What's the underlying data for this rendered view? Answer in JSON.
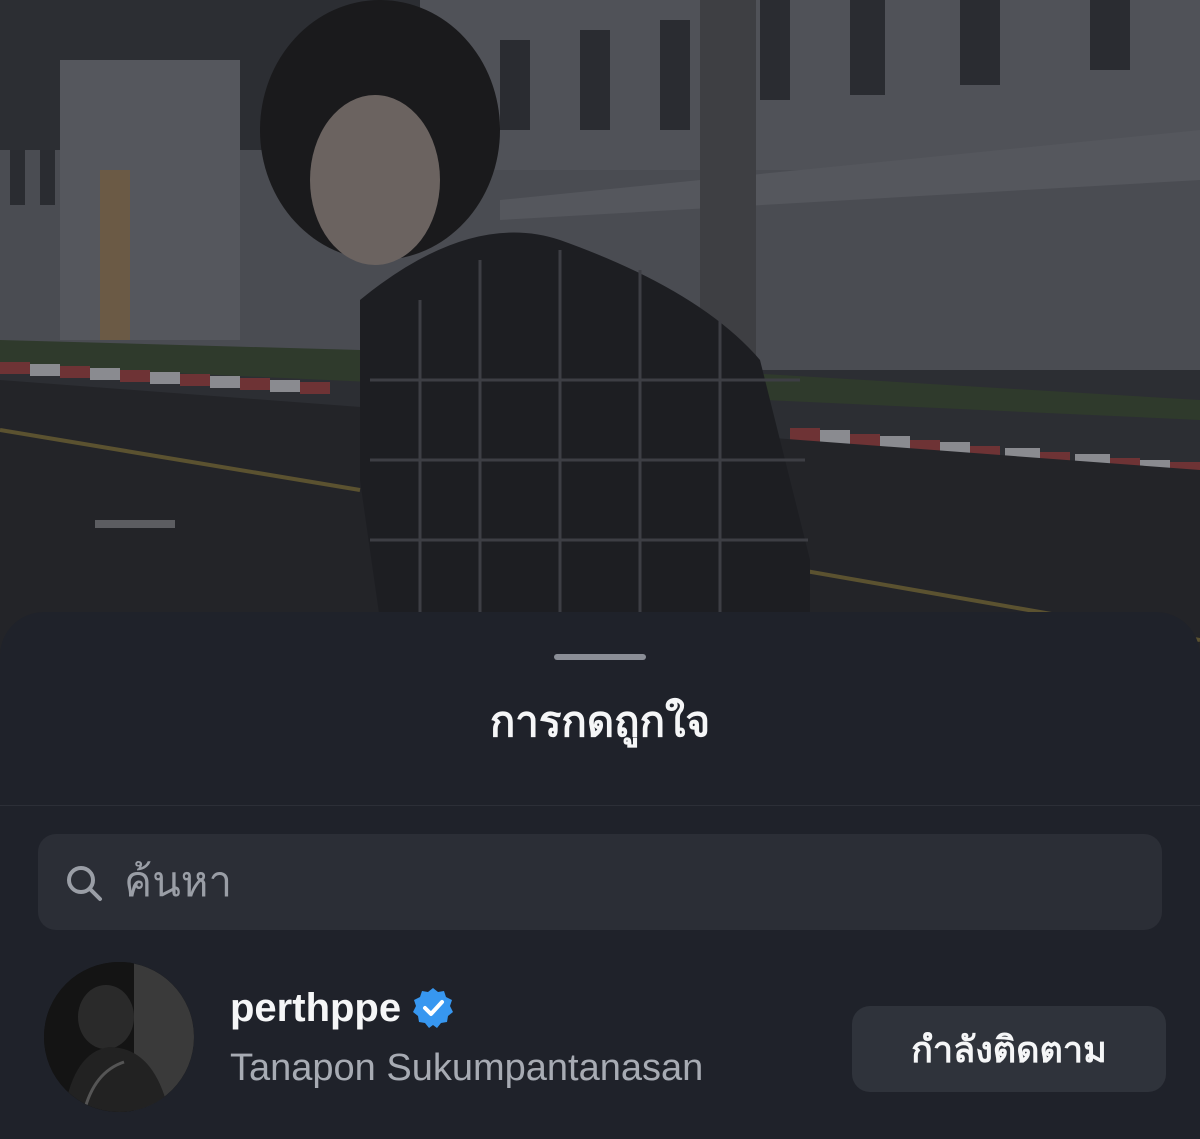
{
  "sheet": {
    "title": "การกดถูกใจ"
  },
  "search": {
    "placeholder": "ค้นหา",
    "value": ""
  },
  "likers": [
    {
      "username": "perthppe",
      "full_name": "Tanapon Sukumpantanasan",
      "verified": true,
      "follow_label": "กำลังติดตาม"
    }
  ],
  "colors": {
    "sheet_bg": "#1f222a",
    "search_bg": "#2b2e36",
    "button_bg": "#2f333b",
    "verified_badge": "#3797f0",
    "secondary_text": "#a7abb3"
  },
  "icons": {
    "search": "search-icon",
    "verified": "verified-badge-icon"
  }
}
